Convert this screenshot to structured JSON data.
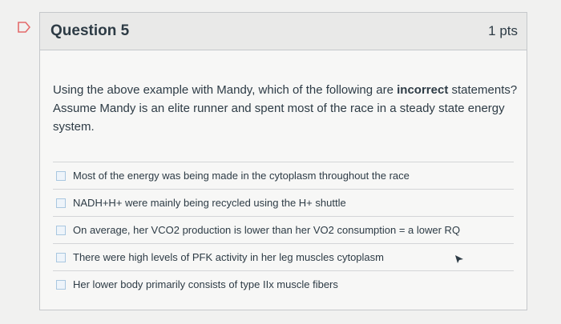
{
  "question": {
    "title": "Question 5",
    "points": "1 pts",
    "text_before_bold": "Using the above example with Mandy, which of the following are ",
    "text_bold": "incorrect",
    "text_after_bold": " statements? Assume Mandy is an elite runner and spent most of the race in a steady state energy system."
  },
  "answers": [
    {
      "label": "Most of the energy was being made in the cytoplasm throughout the race",
      "checked": false
    },
    {
      "label": "NADH+H+ were mainly being recycled using the H+ shuttle",
      "checked": false
    },
    {
      "label": "On average, her VCO2 production is lower than her VO2 consumption = a lower RQ",
      "checked": false
    },
    {
      "label": "There were high levels of PFK activity in her leg muscles cytoplasm",
      "checked": false
    },
    {
      "label": "Her lower body primarily consists of type IIx muscle fibers",
      "checked": false
    }
  ],
  "colors": {
    "flag": "#e46b6b",
    "text": "#2d3b45",
    "checkbox_border": "#a9c7e0"
  },
  "icons": {
    "flag": "flag-icon",
    "cursor": "mouse-pointer-icon"
  }
}
